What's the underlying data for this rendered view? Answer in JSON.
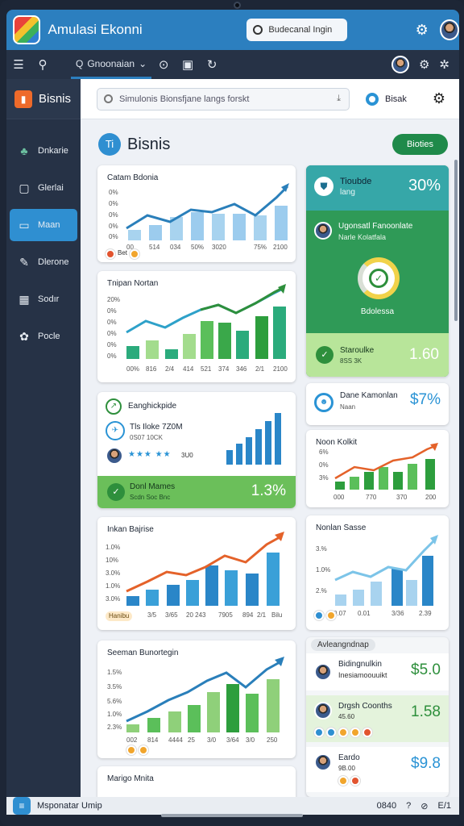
{
  "app": {
    "title": "Amulasi Ekonni",
    "search_placeholder": "Budecanal Ingin"
  },
  "toolbar": {
    "dropdown_label": "Gnoonaian"
  },
  "sidebar": {
    "brand": "Bisnis",
    "items": [
      {
        "label": "Dnkarie",
        "icon": "tree-icon"
      },
      {
        "label": "Glerlai",
        "icon": "doc-icon"
      },
      {
        "label": "Maan",
        "icon": "folder-icon",
        "active": true
      },
      {
        "label": "Dlerone",
        "icon": "pen-icon"
      },
      {
        "label": "Sodır",
        "icon": "grid-icon"
      },
      {
        "label": "Pocle",
        "icon": "gear-icon"
      }
    ]
  },
  "main": {
    "search_placeholder": "Simulonis Bionsfjane langs forskt",
    "action_label": "Bisak",
    "page_title": "Bisnis",
    "page_icon_text": "Ti",
    "page_button": "Bioties"
  },
  "cards": {
    "c1": {
      "title": "Catam Bdonia",
      "yticks": [
        "0%",
        "0%",
        "0%",
        "0%",
        "0%",
        "0%"
      ],
      "xticks": [
        "00",
        "514",
        "034",
        "50%",
        "3020",
        "75%",
        "2100"
      ],
      "badge": "Bet"
    },
    "c2": {
      "title": "Tnipan Nortan",
      "yticks": [
        "20%",
        "0%",
        "0%",
        "0%",
        "0%",
        "0%"
      ],
      "xticks": [
        "00%",
        "816",
        "2/4",
        "414",
        "521",
        "374",
        "346",
        "2/1",
        "2100"
      ]
    },
    "c3": {
      "title": "Eanghickpide",
      "sub1": "Tls Iloke 7Z0M",
      "sub2": "0S07 10CK",
      "rating": "3U0",
      "footer_title": "Donl Mames",
      "footer_sub": "Scdn Soc Bnc",
      "footer_value": "1.3%"
    },
    "c4": {
      "title": "Inkan Bajrise",
      "yticks": [
        "1.0%",
        "10%",
        "3.0%",
        "1.0%",
        "3.0%"
      ],
      "xticks": [
        "3/5",
        "3/65",
        "20 243",
        "7905",
        "894",
        "2/1",
        "Bilu"
      ],
      "badge": "Hanibu"
    },
    "c5": {
      "title": "Seeman Bunortegin",
      "yticks": [
        "1.5%",
        "3.5%",
        "5.6%",
        "1.0%",
        "2.3%"
      ],
      "xticks": [
        "002",
        "814",
        "4444",
        "25",
        "3/0",
        "3/64",
        "3/0",
        "250"
      ]
    },
    "c6": {
      "title": "Marigo Mnita"
    },
    "r1": {
      "title": "Tioubde",
      "sub": "lang",
      "value": "30%",
      "person_title": "Ugonsatl Fanoonlate",
      "person_sub": "Narle Kolatfala",
      "gauge_label": "Bdolessa"
    },
    "r2": {
      "title": "Staroulke",
      "sub": "8SS 3K",
      "value": "1.60"
    },
    "r3": {
      "title": "Dane Kamonlan",
      "sub": "Naan",
      "value": "$7%"
    },
    "r4": {
      "title": "Noon Kolkit",
      "yticks": [
        "6%",
        "0%",
        "3%"
      ],
      "xticks": [
        "000",
        "770",
        "370",
        "200"
      ]
    },
    "r5": {
      "title": "Nonlan Sasse",
      "yticks": [
        "3.%",
        "1.0%",
        "2.%"
      ],
      "xticks": [
        "0.07",
        "0.01",
        "3/36",
        "2.39"
      ]
    },
    "r6": {
      "header": "Avleangndnap",
      "rows": [
        {
          "title": "Bidingnulkin",
          "sub": "Inesiamoouuikt",
          "value": "$5.0"
        },
        {
          "title": "Drgsh Coonths",
          "sub": "45.60",
          "value": "1.58"
        },
        {
          "title": "Eardo",
          "sub": "9B.00",
          "value": "$9.8"
        }
      ]
    }
  },
  "bottom": {
    "label": "Msponatar Umip",
    "time": "0840",
    "right_code": "E/1"
  },
  "colors": {
    "primary": "#2c7fbf",
    "green": "#1f8a4a",
    "orange": "#e4622a"
  }
}
